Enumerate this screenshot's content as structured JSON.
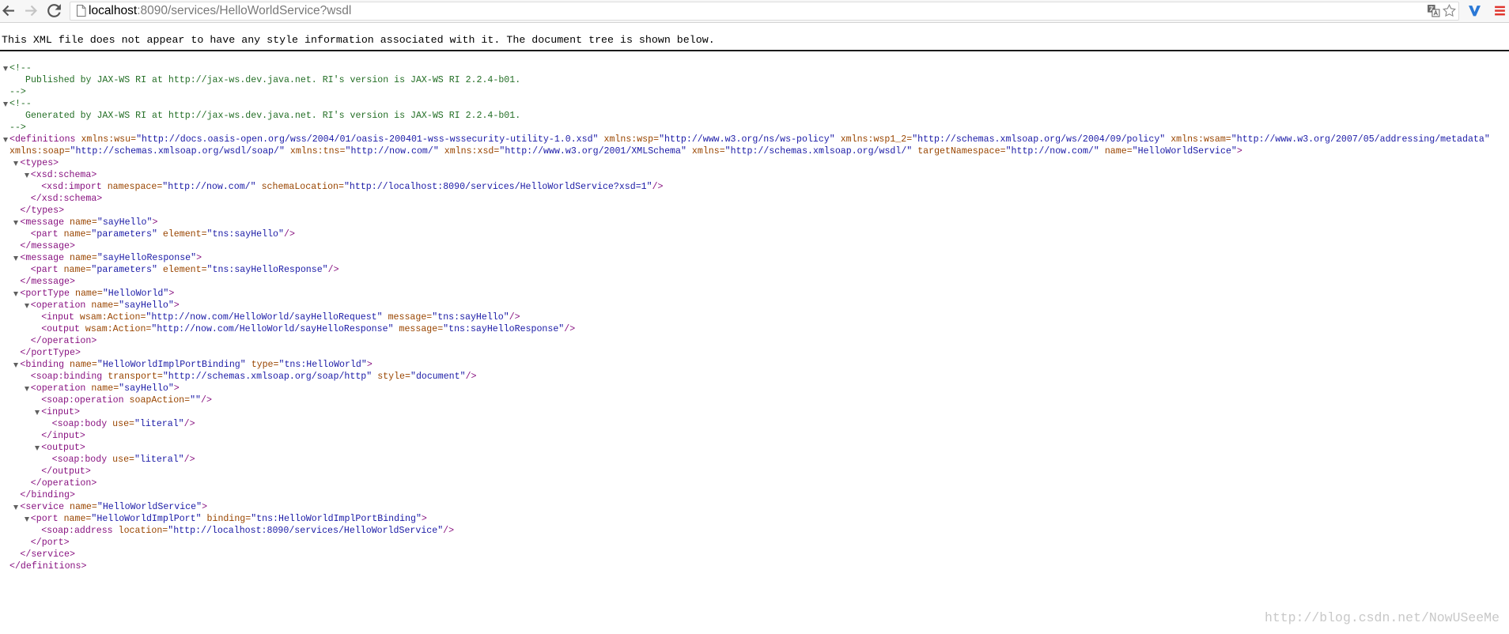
{
  "browser": {
    "url_host": "localhost",
    "url_rest": ":8090/services/HelloWorldService?wsdl",
    "icons": {
      "back": "back-arrow-icon",
      "forward": "forward-arrow-icon",
      "reload": "reload-icon",
      "page": "page-icon",
      "translate": "translate-icon",
      "bookmark": "star-icon",
      "extension": "v-extension-icon",
      "menu": "menu-icon"
    },
    "colors": {
      "url_host": "#000000",
      "url_rest": "#7a7a7a",
      "extension": "#2a78d6",
      "menu": "#e0342c"
    }
  },
  "xml_viewer": {
    "info_message": "This XML file does not appear to have any style information associated with it. The document tree is shown below.",
    "icons": {
      "toggle": "collapse-triangle-icon"
    },
    "colors": {
      "tag": "#881280",
      "attribute_name": "#994500",
      "attribute_value": "#1a1aa6",
      "comment": "#236e25",
      "toggle": "#5f5f5f"
    },
    "syntax": {
      "lt": "<",
      "gt": ">",
      "close_open": "</",
      "self_close": "/>",
      "eq": "=",
      "quote": "\"",
      "comment_open": "<!--",
      "comment_close": "-->"
    },
    "tree": [
      {
        "comment": "Published by JAX-WS RI at http://jax-ws.dev.java.net. RI's version is JAX-WS RI 2.2.4-b01."
      },
      {
        "comment": "Generated by JAX-WS RI at http://jax-ws.dev.java.net. RI's version is JAX-WS RI 2.2.4-b01."
      },
      {
        "name": "definitions",
        "attrs": [
          {
            "name": "xmlns:wsu",
            "value": "http://docs.oasis-open.org/wss/2004/01/oasis-200401-wss-wssecurity-utility-1.0.xsd"
          },
          {
            "name": "xmlns:wsp",
            "value": "http://www.w3.org/ns/ws-policy"
          },
          {
            "name": "xmlns:wsp1_2",
            "value": "http://schemas.xmlsoap.org/ws/2004/09/policy"
          },
          {
            "name": "xmlns:wsam",
            "value": "http://www.w3.org/2007/05/addressing/metadata"
          },
          {
            "name": "xmlns:soap",
            "value": "http://schemas.xmlsoap.org/wsdl/soap/"
          },
          {
            "name": "xmlns:tns",
            "value": "http://now.com/"
          },
          {
            "name": "xmlns:xsd",
            "value": "http://www.w3.org/2001/XMLSchema"
          },
          {
            "name": "xmlns",
            "value": "http://schemas.xmlsoap.org/wsdl/"
          },
          {
            "name": "targetNamespace",
            "value": "http://now.com/"
          },
          {
            "name": "name",
            "value": "HelloWorldService"
          }
        ],
        "children": [
          {
            "name": "types",
            "children": [
              {
                "name": "xsd:schema",
                "children": [
                  {
                    "name": "xsd:import",
                    "attrs": [
                      {
                        "name": "namespace",
                        "value": "http://now.com/"
                      },
                      {
                        "name": "schemaLocation",
                        "value": "http://localhost:8090/services/HelloWorldService?xsd=1"
                      }
                    ]
                  }
                ]
              }
            ]
          },
          {
            "name": "message",
            "attrs": [
              {
                "name": "name",
                "value": "sayHello"
              }
            ],
            "children": [
              {
                "name": "part",
                "attrs": [
                  {
                    "name": "name",
                    "value": "parameters"
                  },
                  {
                    "name": "element",
                    "value": "tns:sayHello"
                  }
                ]
              }
            ]
          },
          {
            "name": "message",
            "attrs": [
              {
                "name": "name",
                "value": "sayHelloResponse"
              }
            ],
            "children": [
              {
                "name": "part",
                "attrs": [
                  {
                    "name": "name",
                    "value": "parameters"
                  },
                  {
                    "name": "element",
                    "value": "tns:sayHelloResponse"
                  }
                ]
              }
            ]
          },
          {
            "name": "portType",
            "attrs": [
              {
                "name": "name",
                "value": "HelloWorld"
              }
            ],
            "children": [
              {
                "name": "operation",
                "attrs": [
                  {
                    "name": "name",
                    "value": "sayHello"
                  }
                ],
                "children": [
                  {
                    "name": "input",
                    "attrs": [
                      {
                        "name": "wsam:Action",
                        "value": "http://now.com/HelloWorld/sayHelloRequest"
                      },
                      {
                        "name": "message",
                        "value": "tns:sayHello"
                      }
                    ]
                  },
                  {
                    "name": "output",
                    "attrs": [
                      {
                        "name": "wsam:Action",
                        "value": "http://now.com/HelloWorld/sayHelloResponse"
                      },
                      {
                        "name": "message",
                        "value": "tns:sayHelloResponse"
                      }
                    ]
                  }
                ]
              }
            ]
          },
          {
            "name": "binding",
            "attrs": [
              {
                "name": "name",
                "value": "HelloWorldImplPortBinding"
              },
              {
                "name": "type",
                "value": "tns:HelloWorld"
              }
            ],
            "children": [
              {
                "name": "soap:binding",
                "attrs": [
                  {
                    "name": "transport",
                    "value": "http://schemas.xmlsoap.org/soap/http"
                  },
                  {
                    "name": "style",
                    "value": "document"
                  }
                ]
              },
              {
                "name": "operation",
                "attrs": [
                  {
                    "name": "name",
                    "value": "sayHello"
                  }
                ],
                "children": [
                  {
                    "name": "soap:operation",
                    "attrs": [
                      {
                        "name": "soapAction",
                        "value": ""
                      }
                    ]
                  },
                  {
                    "name": "input",
                    "children": [
                      {
                        "name": "soap:body",
                        "attrs": [
                          {
                            "name": "use",
                            "value": "literal"
                          }
                        ]
                      }
                    ]
                  },
                  {
                    "name": "output",
                    "children": [
                      {
                        "name": "soap:body",
                        "attrs": [
                          {
                            "name": "use",
                            "value": "literal"
                          }
                        ]
                      }
                    ]
                  }
                ]
              }
            ]
          },
          {
            "name": "service",
            "attrs": [
              {
                "name": "name",
                "value": "HelloWorldService"
              }
            ],
            "children": [
              {
                "name": "port",
                "attrs": [
                  {
                    "name": "name",
                    "value": "HelloWorldImplPort"
                  },
                  {
                    "name": "binding",
                    "value": "tns:HelloWorldImplPortBinding"
                  }
                ],
                "children": [
                  {
                    "name": "soap:address",
                    "attrs": [
                      {
                        "name": "location",
                        "value": "http://localhost:8090/services/HelloWorldService"
                      }
                    ]
                  }
                ]
              }
            ]
          }
        ]
      }
    ]
  },
  "watermark": "http://blog.csdn.net/NowUSeeMe"
}
